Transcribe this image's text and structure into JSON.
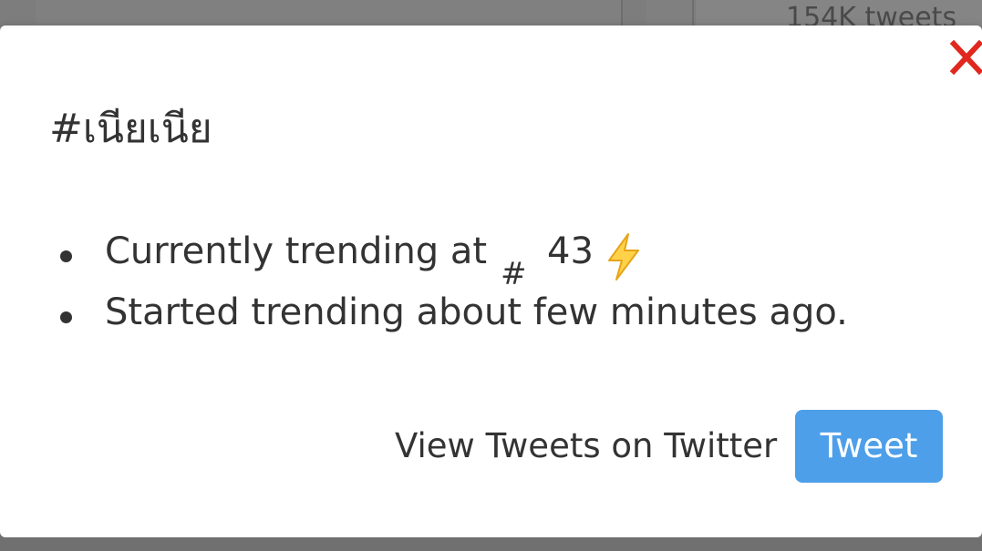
{
  "background": {
    "tweet_count_text": "154K tweets"
  },
  "modal": {
    "title": "#เนียเนีย",
    "close_icon": "close-x-icon",
    "close_color": "#e0281f",
    "info": {
      "trending_prefix": "Currently trending at",
      "rank_hash": "#",
      "rank_number": "43",
      "rank_icon": "lightning-bolt-icon",
      "started_text": "Started trending about few minutes ago."
    },
    "view_link_label": "View Tweets on Twitter",
    "tweet_button_label": "Tweet",
    "tweet_button_color": "#4e9fe9"
  }
}
